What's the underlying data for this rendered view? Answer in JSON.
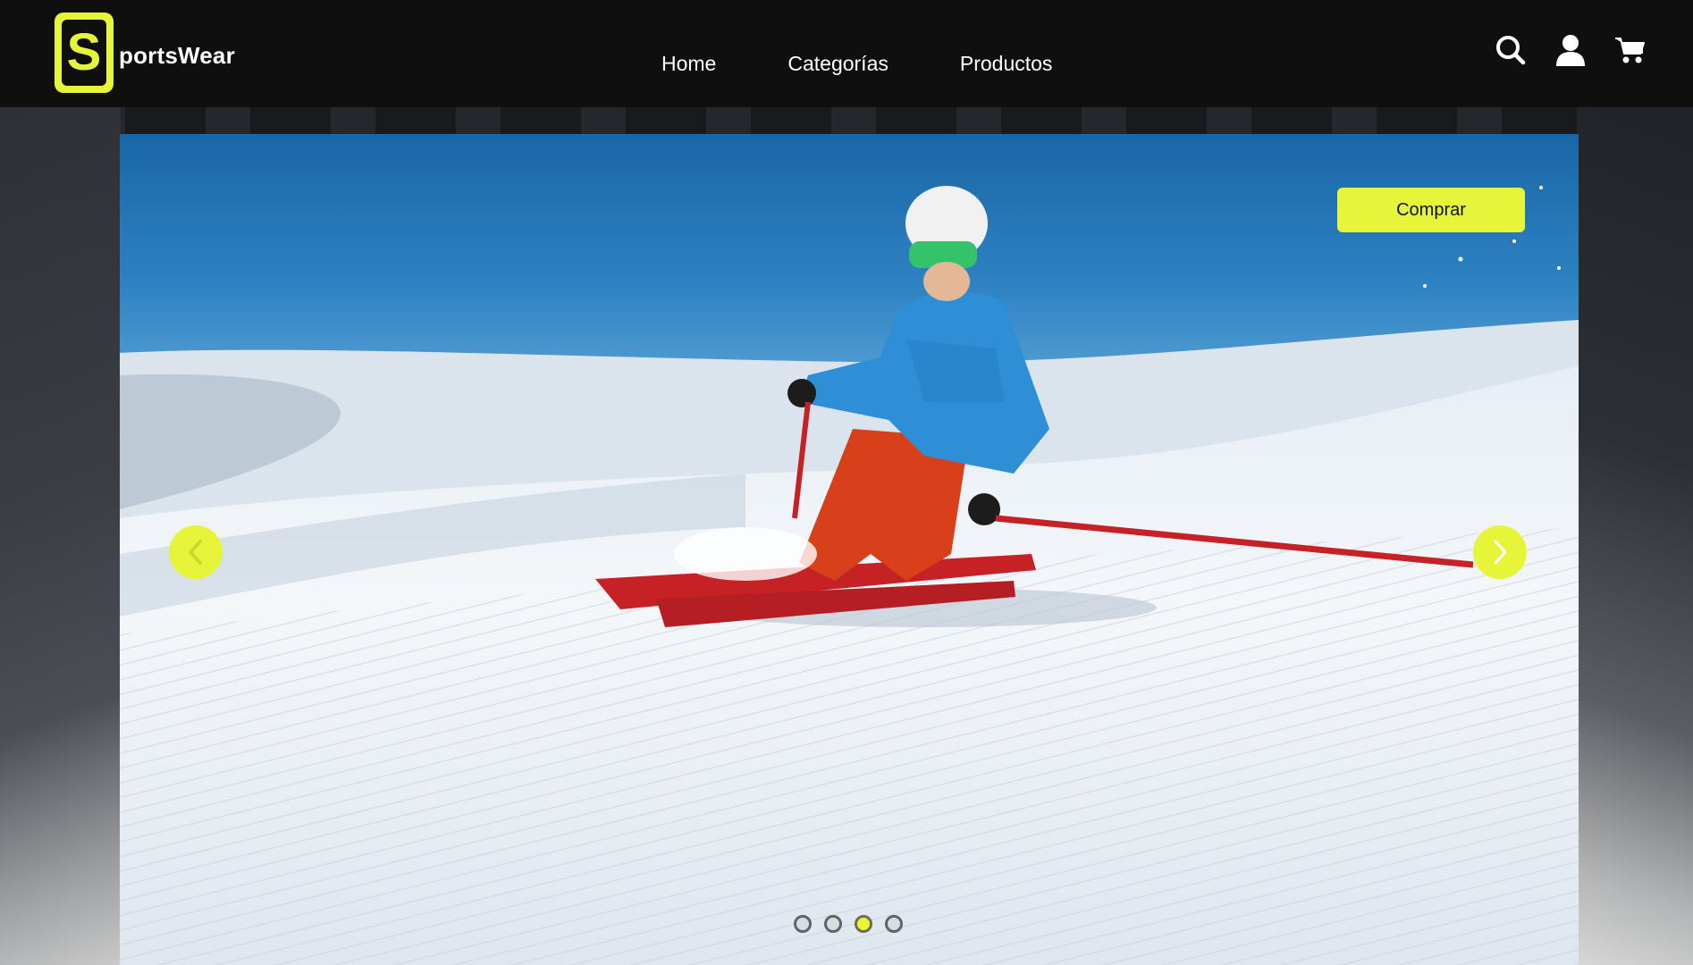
{
  "brand": {
    "logo_letter": "S",
    "name": "portsWear",
    "accent_color": "#e6f53a"
  },
  "nav": {
    "items": [
      "Home",
      "Categorías",
      "Productos"
    ]
  },
  "header_icons": [
    "search-icon",
    "user-icon",
    "cart-icon"
  ],
  "hero": {
    "cta_label": "Comprar",
    "prev_icon": "chevron-left-icon",
    "next_icon": "chevron-right-icon",
    "slide_count": 4,
    "active_slide": 3,
    "image_subject": "skier on groomed slope"
  }
}
